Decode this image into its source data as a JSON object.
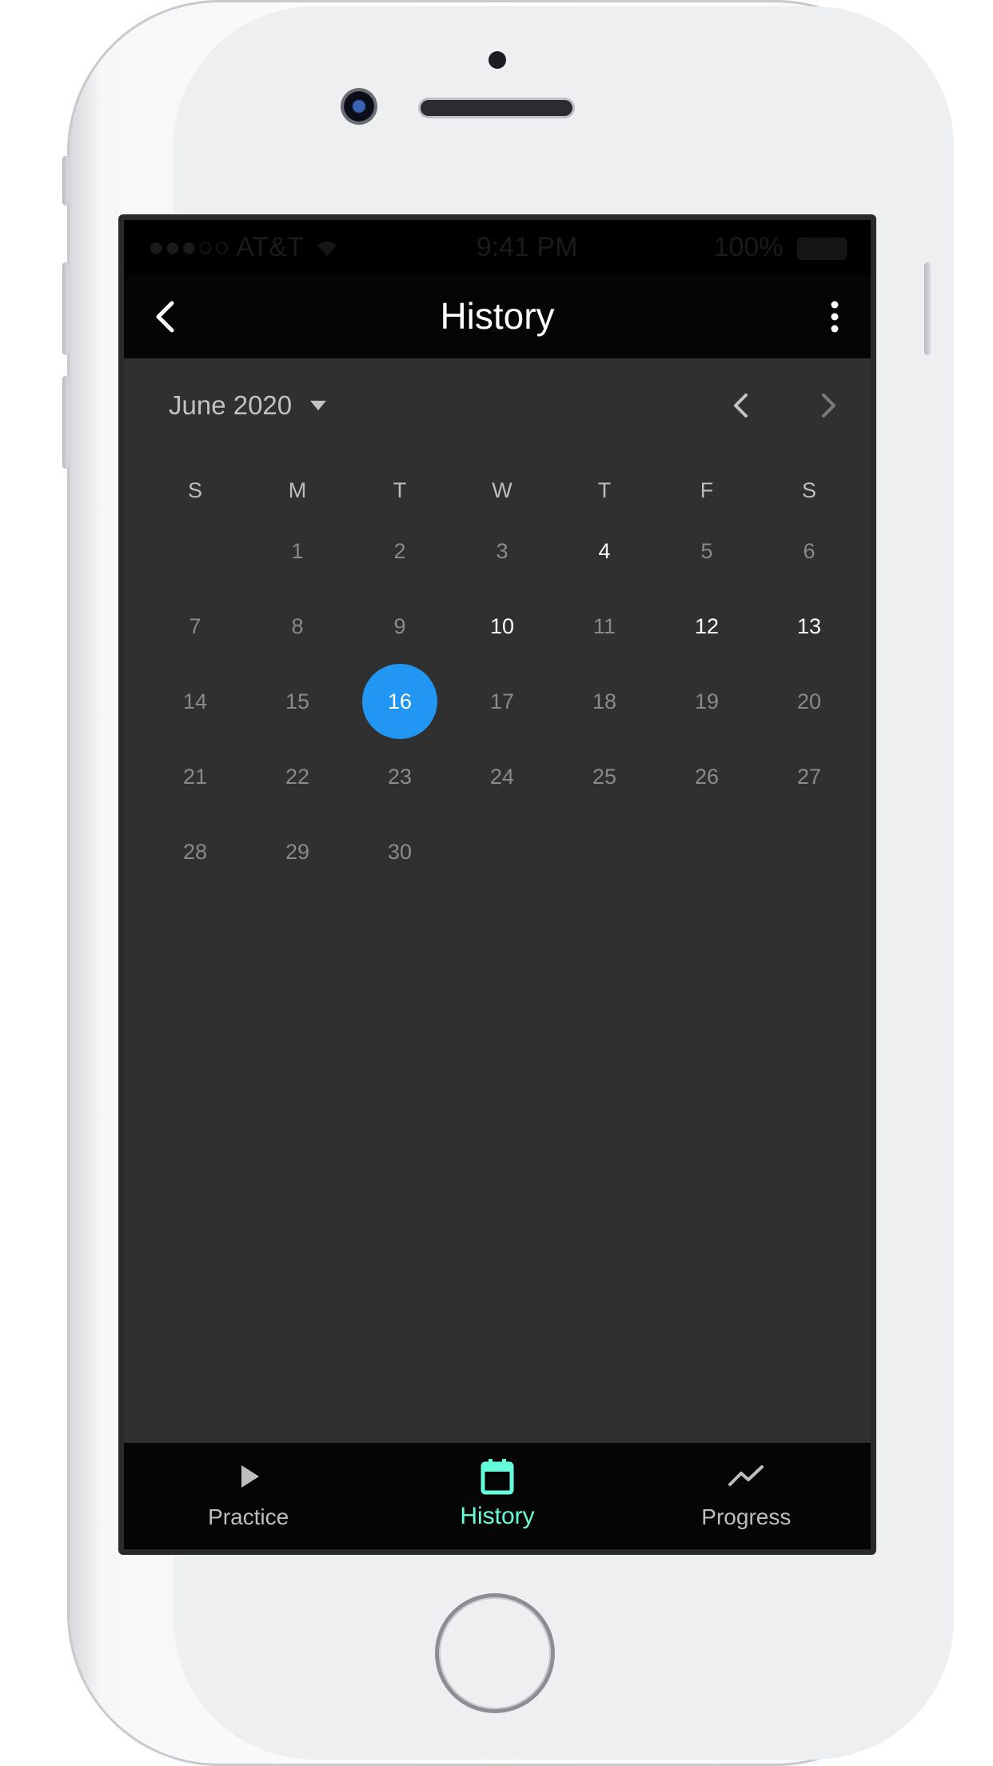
{
  "status_bar": {
    "carrier": "●●●○○ AT&T",
    "time": "9:41 PM",
    "battery": "100%"
  },
  "app_bar": {
    "title": "History",
    "back_icon": "chevron-left-icon",
    "more_icon": "more-vert-icon"
  },
  "calendar": {
    "month_label": "June 2020",
    "weekdays": [
      "S",
      "M",
      "T",
      "W",
      "T",
      "F",
      "S"
    ],
    "weeks": [
      [
        "",
        "1",
        "2",
        "3",
        "4",
        "5",
        "6"
      ],
      [
        "7",
        "8",
        "9",
        "10",
        "11",
        "12",
        "13"
      ],
      [
        "14",
        "15",
        "16",
        "17",
        "18",
        "19",
        "20"
      ],
      [
        "21",
        "22",
        "23",
        "24",
        "25",
        "26",
        "27"
      ],
      [
        "28",
        "29",
        "30",
        "",
        "",
        "",
        ""
      ]
    ],
    "active_days": [
      "4",
      "10",
      "12",
      "13"
    ],
    "selected_day": "16",
    "selected_color": "#2196f3"
  },
  "bottom_nav": {
    "items": [
      {
        "label": "Practice",
        "icon": "play-icon"
      },
      {
        "label": "History",
        "icon": "calendar-icon"
      },
      {
        "label": "Progress",
        "icon": "trending-up-icon"
      }
    ],
    "active_index": 1,
    "active_color": "#64ffda"
  }
}
